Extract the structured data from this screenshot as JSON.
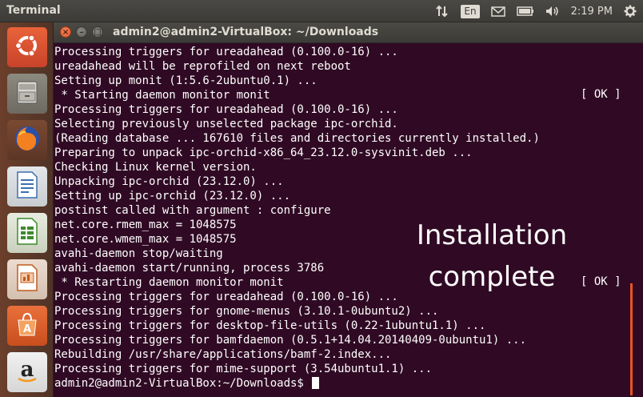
{
  "panel": {
    "app_title": "Terminal",
    "keyboard_layout": "En",
    "clock": "2:19 PM"
  },
  "launcher": {
    "items": [
      {
        "name": "Ubuntu dash",
        "icon": "ubuntu-logo-icon"
      },
      {
        "name": "Files",
        "icon": "file-cabinet-icon"
      },
      {
        "name": "Firefox",
        "icon": "firefox-icon"
      },
      {
        "name": "LibreOffice Writer",
        "icon": "writer-document-icon"
      },
      {
        "name": "LibreOffice Calc",
        "icon": "calc-spreadsheet-icon"
      },
      {
        "name": "LibreOffice Impress",
        "icon": "impress-presentation-icon"
      },
      {
        "name": "Ubuntu Software Center",
        "icon": "software-center-icon"
      },
      {
        "name": "Amazon",
        "icon": "amazon-icon"
      }
    ]
  },
  "window": {
    "title": "admin2@admin2-VirtualBox: ~/Downloads",
    "close_glyph": "×",
    "min_glyph": "–",
    "max_glyph": "□"
  },
  "terminal": {
    "lines": [
      "Processing triggers for ureadahead (0.100.0-16) ...",
      "ureadahead will be reprofiled on next reboot",
      "Setting up monit (1:5.6-2ubuntu0.1) ...",
      " * Starting daemon monitor monit",
      "Processing triggers for ureadahead (0.100.0-16) ...",
      "Selecting previously unselected package ipc-orchid.",
      "(Reading database ... 167610 files and directories currently installed.)",
      "Preparing to unpack ipc-orchid-x86_64_23.12.0-sysvinit.deb ...",
      "Checking Linux kernel version.",
      "Unpacking ipc-orchid (23.12.0) ...",
      "Setting up ipc-orchid (23.12.0) ...",
      "postinst called with argument : configure",
      "net.core.rmem_max = 1048575",
      "net.core.wmem_max = 1048575",
      "avahi-daemon stop/waiting",
      "avahi-daemon start/running, process 3786",
      " * Restarting daemon monitor monit",
      "Processing triggers for ureadahead (0.100.0-16) ...",
      "Processing triggers for gnome-menus (3.10.1-0ubuntu2) ...",
      "Processing triggers for desktop-file-utils (0.22-1ubuntu1.1) ...",
      "Processing triggers for bamfdaemon (0.5.1+14.04.20140409-0ubuntu1) ...",
      "Rebuilding /usr/share/applications/bamf-2.index...",
      "Processing triggers for mime-support (3.54ubuntu1.1) ...",
      "admin2@admin2-VirtualBox:~/Downloads$ "
    ],
    "ok_status_1": "[ OK ]",
    "ok_status_2": "[ OK ]"
  },
  "overlay": {
    "line1": "Installation",
    "line2": "complete"
  },
  "colors": {
    "terminal_bg": "#300a24",
    "accent": "#e95420",
    "panel_bg": "#3c3b37"
  }
}
